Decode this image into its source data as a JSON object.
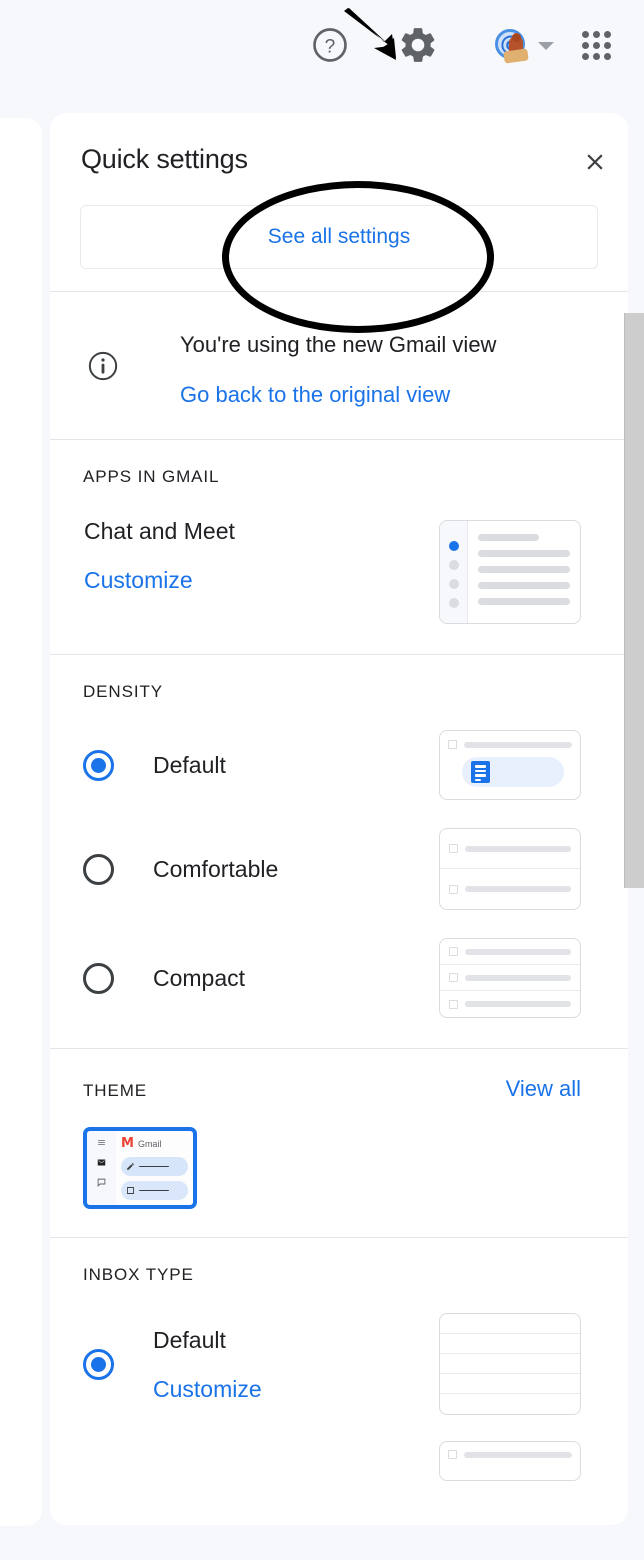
{
  "topbar": {
    "help_icon": "help-circle-icon",
    "settings_icon": "gear-icon",
    "account_icon": "account-avatar",
    "caret_icon": "chevron-down-icon",
    "apps_icon": "apps-grid-icon"
  },
  "panel": {
    "title": "Quick settings",
    "close_icon": "close-icon",
    "see_all_settings_label": "See all settings"
  },
  "notice": {
    "info_icon": "info-icon",
    "text": "You're using the new Gmail view",
    "link_label": "Go back to the original view"
  },
  "apps_in_gmail": {
    "section_title": "APPS IN GMAIL",
    "item_label": "Chat and Meet",
    "customize_label": "Customize"
  },
  "density": {
    "section_title": "DENSITY",
    "options": [
      {
        "label": "Default",
        "selected": true
      },
      {
        "label": "Comfortable",
        "selected": false
      },
      {
        "label": "Compact",
        "selected": false
      }
    ]
  },
  "theme": {
    "section_title": "THEME",
    "view_all_label": "View all",
    "thumb_brand_mark": "M",
    "thumb_brand_text": "Gmail",
    "selected": true
  },
  "inbox_type": {
    "section_title": "INBOX TYPE",
    "options": [
      {
        "label": "Default",
        "customize_label": "Customize",
        "selected": true
      }
    ]
  },
  "scrollbar": {
    "name": "panel-vertical-scrollbar"
  },
  "annotations": {
    "arrow": "arrow-pointing-to-settings-gear",
    "ellipse": "ellipse-highlighting-see-all-settings"
  },
  "colors": {
    "accent_blue": "#1a73e8",
    "text_primary": "#202124",
    "page_bg": "#f6f8fc",
    "panel_bg": "#ffffff",
    "divider": "#e4e6e9",
    "annotation": "#000000"
  }
}
